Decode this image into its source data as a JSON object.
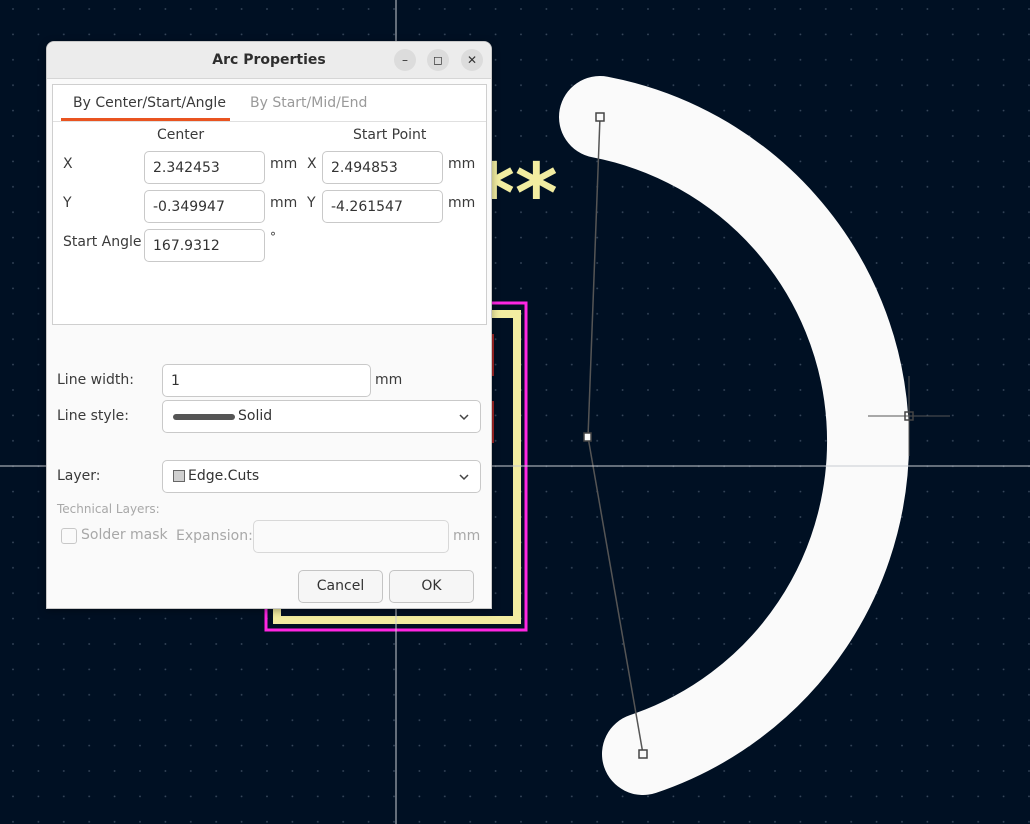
{
  "dialog": {
    "title": "Arc Properties",
    "window_buttons": {
      "minimize": "–",
      "maximize": "◻",
      "close": "✕"
    },
    "tabs": [
      {
        "label": "By Center/Start/Angle",
        "active": true
      },
      {
        "label": "By Start/Mid/End",
        "active": false
      }
    ],
    "center": {
      "heading": "Center",
      "x_label": "X",
      "x_value": "2.342453",
      "x_unit": "mm",
      "y_label": "Y",
      "y_value": "-0.349947",
      "y_unit": "mm"
    },
    "start_point": {
      "heading": "Start Point",
      "x_label": "X",
      "x_value": "2.494853",
      "x_unit": "mm",
      "y_label": "Y",
      "y_value": "-4.261547",
      "y_unit": "mm"
    },
    "start_angle": {
      "label": "Start Angle",
      "value": "167.9312",
      "unit": "°"
    },
    "line_width": {
      "label": "Line width:",
      "value": "1",
      "unit": "mm"
    },
    "line_style": {
      "label": "Line style:",
      "value": "Solid"
    },
    "layer": {
      "label": "Layer:",
      "value": "Edge.Cuts"
    },
    "technical_layers": {
      "heading": "Technical Layers:",
      "solder_mask_label": "Solder mask",
      "expansion_label": "Expansion:",
      "expansion_value": "",
      "expansion_unit": "mm"
    },
    "buttons": {
      "cancel": "Cancel",
      "ok": "OK"
    }
  },
  "canvas": {
    "background_color": "#001023",
    "grid_color": "#3a4a5e",
    "arc_color": "#fafafa",
    "silkscreen_color": "#f2eda1",
    "courtyard_color": "#ff26e2",
    "pad_color": "#a32626",
    "crosshair_color": "#c8ccd2",
    "reference_text": "**"
  }
}
